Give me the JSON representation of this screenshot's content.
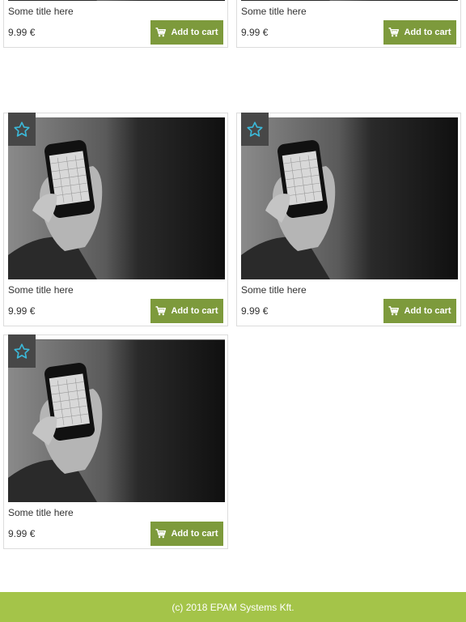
{
  "products": [
    {
      "title": "Some title here",
      "price": "9.99 €",
      "button": "Add to cart",
      "icon": "star-outline-icon"
    },
    {
      "title": "Some title here",
      "price": "9.99 €",
      "button": "Add to cart",
      "icon": "star-outline-icon"
    },
    {
      "title": "Some title here",
      "price": "9.99 €",
      "button": "Add to cart",
      "icon": "star-outline-icon"
    },
    {
      "title": "Some title here",
      "price": "9.99 €",
      "button": "Add to cart",
      "icon": "star-outline-icon"
    },
    {
      "title": "Some title here",
      "price": "9.99 €",
      "button": "Add to cart",
      "icon": "star-outline-icon"
    }
  ],
  "footer": {
    "text": "(c) 2018 EPAM Systems Kft."
  },
  "colors": {
    "button": "#7d9a3c",
    "footer": "#a4c449",
    "star": "#3bb8d8",
    "favbox": "#474747"
  }
}
